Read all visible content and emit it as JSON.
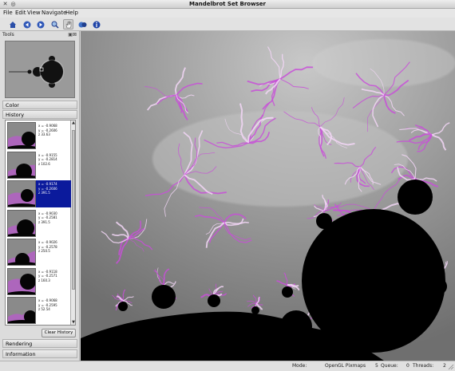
{
  "window": {
    "title": "Mandelbrot Set Browser"
  },
  "menu": [
    "File",
    "Edit",
    "View",
    "Navigate",
    "Help"
  ],
  "toolbar": {
    "buttons": [
      "home-icon",
      "back-icon",
      "forward-icon",
      "zoom-icon",
      "pan-hand-icon",
      "render-icon",
      "info-icon"
    ]
  },
  "tools": {
    "dock_title": "Tools",
    "sections": {
      "color": "Color",
      "history": "History",
      "rendering": "Rendering",
      "information": "Information"
    },
    "clear_history": "Clear History",
    "history": [
      {
        "x": "x = -0.9068",
        "y": "y = -0.2606",
        "z": "z 33.63"
      },
      {
        "x": "x = -0.9155",
        "y": "y = -0.2814",
        "z": "z 102.6"
      },
      {
        "x": "x = -0.9174",
        "y": "y = -0.2606",
        "z": "z 391.5"
      },
      {
        "x": "x = -0.9030",
        "y": "y = -0.2581",
        "z": "z 391.5"
      },
      {
        "x": "x = -0.9026",
        "y": "y = -0.2578",
        "z": "z 250.5"
      },
      {
        "x": "x = -0.9118",
        "y": "y = -0.2571",
        "z": "z 160.3"
      },
      {
        "x": "x = -0.9068",
        "y": "y = -0.2595",
        "z": "z 52.54"
      }
    ],
    "selected_index": 2
  },
  "status": {
    "mode_label": "Mode:",
    "mode_value": "OpenGL Pixmaps",
    "queue_label": "Queue:",
    "queue_value": "0",
    "threads_label": "Threads:",
    "threads_value": "2",
    "extra": "5"
  },
  "colors": {
    "fractal_accent": "#c84fd8",
    "selection": "#0b1a9c"
  }
}
